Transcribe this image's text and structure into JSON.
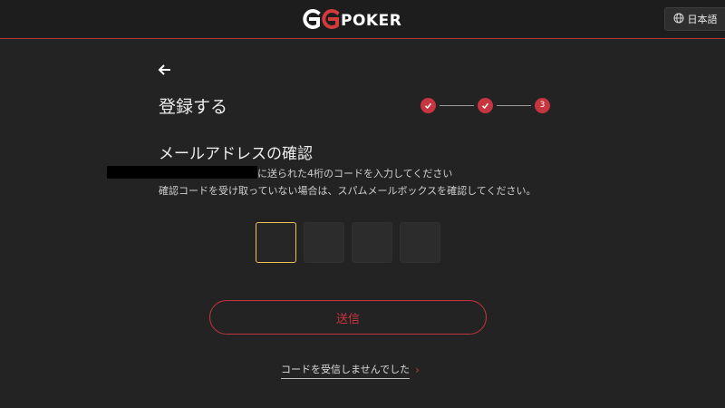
{
  "header": {
    "logo_text": "POKER",
    "logo_mark": "GG",
    "language_label": "日本語",
    "language_icon": "globe-icon"
  },
  "nav": {
    "back_icon": "back-arrow-icon"
  },
  "page": {
    "title": "登録する"
  },
  "stepper": {
    "total_steps": 3,
    "current_step": 3,
    "steps": [
      {
        "state": "complete",
        "icon": "check-icon"
      },
      {
        "state": "complete",
        "icon": "check-icon"
      },
      {
        "state": "current",
        "label": "3"
      }
    ]
  },
  "verify": {
    "title": "メールアドレスの確認",
    "instruction_1": "に送られた4桁のコードを入力してください",
    "instruction_2": "確認コードを受け取っていない場合は、スパムメールボックスを確認してください。",
    "code_values": [
      "",
      "",
      "",
      ""
    ]
  },
  "actions": {
    "submit_label": "送信",
    "resend_label": "コードを受信しませんでした",
    "resend_icon": "chevron-right-icon"
  },
  "colors": {
    "accent": "#c7353f",
    "focus": "#e8c25a",
    "background": "#232323"
  }
}
